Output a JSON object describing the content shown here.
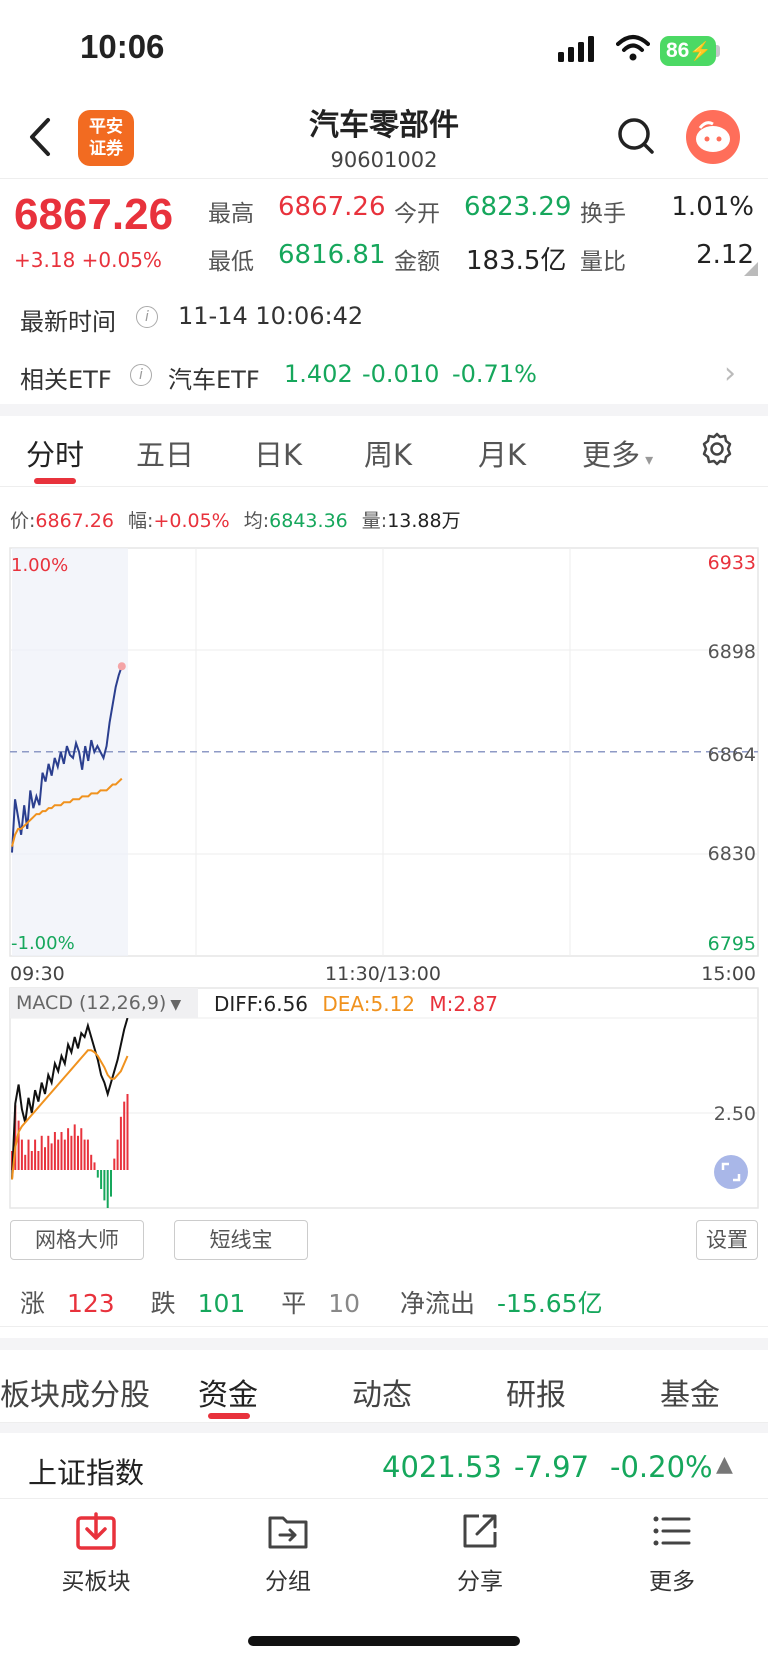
{
  "status_bar": {
    "time": "10:06",
    "battery": "86"
  },
  "header": {
    "logo_line1": "平安",
    "logo_line2": "证券",
    "title": "汽车零部件",
    "code": "90601002"
  },
  "quote": {
    "last": "6867.26",
    "change": "+3.18 +0.05%",
    "high_label": "最高",
    "high": "6867.26",
    "open_label": "今开",
    "open": "6823.29",
    "turnover_label": "换手",
    "turnover": "1.01%",
    "low_label": "最低",
    "low": "6816.81",
    "amount_label": "金额",
    "amount": "183.5亿",
    "vol_ratio_label": "量比",
    "vol_ratio": "2.12"
  },
  "latest_time": {
    "label": "最新时间",
    "value": "11-14 10:06:42"
  },
  "etf": {
    "label": "相关ETF",
    "name": "汽车ETF",
    "price": "1.402",
    "change": "-0.010",
    "pct": "-0.71%"
  },
  "period_tabs": [
    "分时",
    "五日",
    "日K",
    "周K",
    "月K",
    "更多"
  ],
  "stats": {
    "price_label": "价:",
    "price": "6867.26",
    "amp_label": "幅:",
    "amp": "+0.05%",
    "avg_label": "均:",
    "avg": "6843.36",
    "vol_label": "量:",
    "vol": "13.88万"
  },
  "chart_data": {
    "type": "line",
    "x_ticks": [
      "09:30",
      "11:30/13:00",
      "15:00"
    ],
    "y_ticks_right": [
      "6933",
      "6898",
      "6864",
      "6830",
      "6795"
    ],
    "y_ticks_left": [
      "1.00%",
      "-1.00%"
    ],
    "ylim": [
      6795,
      6933
    ],
    "prev_close": 6864.08,
    "series": [
      {
        "color": "#2b3f8f",
        "values": [
          6830,
          6848,
          6842,
          6836,
          6846,
          6838,
          6851,
          6845,
          6849,
          6846,
          6857,
          6854,
          6860,
          6856,
          6862,
          6859,
          6864,
          6860,
          6866,
          6863,
          6862,
          6867,
          6864,
          6858,
          6866,
          6861,
          6868,
          6864,
          6866,
          6864,
          6862,
          6866,
          6874,
          6880,
          6886,
          6890,
          6893
        ]
      },
      {
        "color": "#f0921e",
        "values": [
          6832,
          6836,
          6838,
          6838,
          6839,
          6840,
          6841,
          6842,
          6843,
          6843,
          6844,
          6844,
          6845,
          6845,
          6846,
          6846,
          6846,
          6847,
          6847,
          6847,
          6848,
          6848,
          6848,
          6849,
          6849,
          6849,
          6850,
          6850,
          6850,
          6851,
          6851,
          6851,
          6852,
          6853,
          6853,
          6854,
          6855
        ]
      }
    ]
  },
  "macd": {
    "title": "MACD (12,26,9)",
    "diff": "DIFF:6.56",
    "dea": "DEA:5.12",
    "m": "M:2.87",
    "y_tick": "2.50",
    "ylim": [
      -2,
      8
    ],
    "diff_values": [
      -0.5,
      3.5,
      4.5,
      3.2,
      2.5,
      3.8,
      3.0,
      4.2,
      3.6,
      4.6,
      4.0,
      5.0,
      4.6,
      5.6,
      5.2,
      6.0,
      5.6,
      6.6,
      6.2,
      7.0,
      6.4,
      7.2,
      7.0,
      7.6,
      7.0,
      6.4,
      5.8,
      5.0,
      4.6,
      4.0,
      4.6,
      5.2,
      5.8,
      6.6,
      7.4,
      8.0
    ],
    "dea_values": [
      -0.5,
      1.2,
      2.0,
      2.3,
      2.5,
      2.7,
      2.9,
      3.1,
      3.3,
      3.5,
      3.7,
      3.9,
      4.1,
      4.3,
      4.5,
      4.7,
      4.9,
      5.1,
      5.3,
      5.5,
      5.7,
      5.9,
      6.1,
      6.3,
      6.3,
      6.2,
      6.0,
      5.7,
      5.4,
      5.0,
      4.8,
      4.8,
      5.0,
      5.2,
      5.6,
      6.0
    ],
    "hist_values": [
      1.0,
      3.4,
      2.6,
      1.6,
      0.8,
      1.6,
      1.0,
      1.6,
      1.0,
      1.8,
      1.2,
      1.8,
      1.4,
      2.0,
      1.6,
      2.0,
      1.6,
      2.2,
      1.8,
      2.4,
      1.8,
      2.2,
      1.6,
      1.6,
      0.8,
      0.4,
      -0.4,
      -1.0,
      -1.6,
      -2.0,
      -1.4,
      0.6,
      1.6,
      2.8,
      3.6,
      4.0
    ]
  },
  "tools": {
    "grid": "网格大师",
    "short": "短线宝",
    "settings": "设置"
  },
  "breadth": {
    "up_label": "涨",
    "up": "123",
    "down_label": "跌",
    "down": "101",
    "flat_label": "平",
    "flat": "10",
    "flow_label": "净流出",
    "flow": "-15.65亿"
  },
  "bottom_tabs": [
    "板块成分股",
    "资金",
    "动态",
    "研报",
    "基金"
  ],
  "index": {
    "name": "上证指数",
    "value": "4021.53",
    "change": "-7.97",
    "pct": "-0.20%"
  },
  "nav": [
    "买板块",
    "分组",
    "分享",
    "更多"
  ],
  "colors": {
    "up": "#e8323c",
    "down": "#16a75c",
    "brand": "#f26b21"
  }
}
